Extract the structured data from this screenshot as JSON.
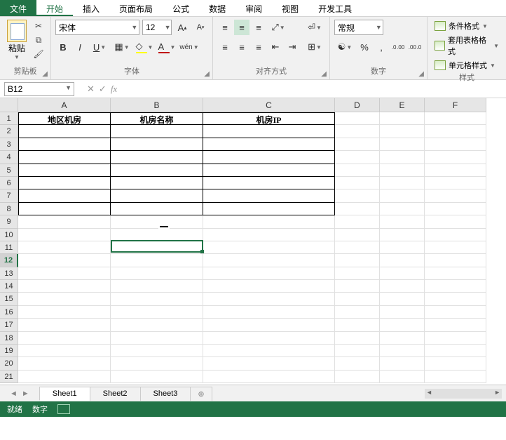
{
  "tabs": {
    "file": "文件",
    "home": "开始",
    "insert": "插入",
    "layout": "页面布局",
    "formulas": "公式",
    "data": "数据",
    "review": "审阅",
    "view": "视图",
    "dev": "开发工具"
  },
  "ribbon": {
    "clipboard": {
      "paste": "粘贴",
      "label": "剪贴板"
    },
    "font": {
      "name": "宋体",
      "size": "12",
      "label": "字体",
      "pinyin": "wén"
    },
    "align": {
      "label": "对齐方式"
    },
    "number": {
      "format": "常规",
      "label": "数字",
      "percent": "%",
      "comma": ",",
      "dec_inc": ".0 .00",
      "dec_dec": ".00 .0"
    },
    "styles": {
      "cond": "条件格式",
      "table": "套用表格格式",
      "cell": "单元格样式",
      "label": "样式"
    }
  },
  "formula_bar": {
    "cell_ref": "B12",
    "cancel": "✕",
    "confirm": "✓",
    "fx": "fx"
  },
  "columns": [
    "A",
    "B",
    "C",
    "D",
    "E",
    "F"
  ],
  "row_count": 21,
  "selected_row": 12,
  "headers": {
    "A": "地区机房",
    "B": "机房名称",
    "C": "机房IP"
  },
  "sheet_tabs": {
    "s1": "Sheet1",
    "s2": "Sheet2",
    "s3": "Sheet3",
    "add": "⊕"
  },
  "status": {
    "ready": "就绪",
    "num": "数字"
  }
}
